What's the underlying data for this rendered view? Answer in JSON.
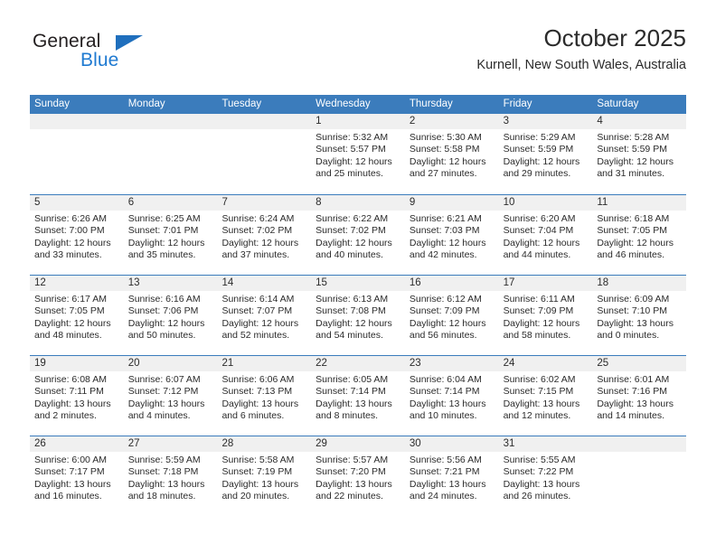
{
  "brand": {
    "name_part1": "General",
    "name_part2": "Blue",
    "triangle_icon": "triangle-icon",
    "accent_color": "#1f7ad1"
  },
  "header": {
    "title": "October 2025",
    "subtitle": "Kurnell, New South Wales, Australia"
  },
  "theme": {
    "header_blue": "#3b7cbc",
    "day_band_gray": "#f0f0f0",
    "text_color": "#2b2b2b"
  },
  "weekdays": [
    "Sunday",
    "Monday",
    "Tuesday",
    "Wednesday",
    "Thursday",
    "Friday",
    "Saturday"
  ],
  "weeks": [
    [
      {
        "day": "",
        "empty": true
      },
      {
        "day": "",
        "empty": true
      },
      {
        "day": "",
        "empty": true
      },
      {
        "day": "1",
        "sunrise": "Sunrise: 5:32 AM",
        "sunset": "Sunset: 5:57 PM",
        "daylight_line1": "Daylight: 12 hours",
        "daylight_line2": "and 25 minutes."
      },
      {
        "day": "2",
        "sunrise": "Sunrise: 5:30 AM",
        "sunset": "Sunset: 5:58 PM",
        "daylight_line1": "Daylight: 12 hours",
        "daylight_line2": "and 27 minutes."
      },
      {
        "day": "3",
        "sunrise": "Sunrise: 5:29 AM",
        "sunset": "Sunset: 5:59 PM",
        "daylight_line1": "Daylight: 12 hours",
        "daylight_line2": "and 29 minutes."
      },
      {
        "day": "4",
        "sunrise": "Sunrise: 5:28 AM",
        "sunset": "Sunset: 5:59 PM",
        "daylight_line1": "Daylight: 12 hours",
        "daylight_line2": "and 31 minutes."
      }
    ],
    [
      {
        "day": "5",
        "sunrise": "Sunrise: 6:26 AM",
        "sunset": "Sunset: 7:00 PM",
        "daylight_line1": "Daylight: 12 hours",
        "daylight_line2": "and 33 minutes."
      },
      {
        "day": "6",
        "sunrise": "Sunrise: 6:25 AM",
        "sunset": "Sunset: 7:01 PM",
        "daylight_line1": "Daylight: 12 hours",
        "daylight_line2": "and 35 minutes."
      },
      {
        "day": "7",
        "sunrise": "Sunrise: 6:24 AM",
        "sunset": "Sunset: 7:02 PM",
        "daylight_line1": "Daylight: 12 hours",
        "daylight_line2": "and 37 minutes."
      },
      {
        "day": "8",
        "sunrise": "Sunrise: 6:22 AM",
        "sunset": "Sunset: 7:02 PM",
        "daylight_line1": "Daylight: 12 hours",
        "daylight_line2": "and 40 minutes."
      },
      {
        "day": "9",
        "sunrise": "Sunrise: 6:21 AM",
        "sunset": "Sunset: 7:03 PM",
        "daylight_line1": "Daylight: 12 hours",
        "daylight_line2": "and 42 minutes."
      },
      {
        "day": "10",
        "sunrise": "Sunrise: 6:20 AM",
        "sunset": "Sunset: 7:04 PM",
        "daylight_line1": "Daylight: 12 hours",
        "daylight_line2": "and 44 minutes."
      },
      {
        "day": "11",
        "sunrise": "Sunrise: 6:18 AM",
        "sunset": "Sunset: 7:05 PM",
        "daylight_line1": "Daylight: 12 hours",
        "daylight_line2": "and 46 minutes."
      }
    ],
    [
      {
        "day": "12",
        "sunrise": "Sunrise: 6:17 AM",
        "sunset": "Sunset: 7:05 PM",
        "daylight_line1": "Daylight: 12 hours",
        "daylight_line2": "and 48 minutes."
      },
      {
        "day": "13",
        "sunrise": "Sunrise: 6:16 AM",
        "sunset": "Sunset: 7:06 PM",
        "daylight_line1": "Daylight: 12 hours",
        "daylight_line2": "and 50 minutes."
      },
      {
        "day": "14",
        "sunrise": "Sunrise: 6:14 AM",
        "sunset": "Sunset: 7:07 PM",
        "daylight_line1": "Daylight: 12 hours",
        "daylight_line2": "and 52 minutes."
      },
      {
        "day": "15",
        "sunrise": "Sunrise: 6:13 AM",
        "sunset": "Sunset: 7:08 PM",
        "daylight_line1": "Daylight: 12 hours",
        "daylight_line2": "and 54 minutes."
      },
      {
        "day": "16",
        "sunrise": "Sunrise: 6:12 AM",
        "sunset": "Sunset: 7:09 PM",
        "daylight_line1": "Daylight: 12 hours",
        "daylight_line2": "and 56 minutes."
      },
      {
        "day": "17",
        "sunrise": "Sunrise: 6:11 AM",
        "sunset": "Sunset: 7:09 PM",
        "daylight_line1": "Daylight: 12 hours",
        "daylight_line2": "and 58 minutes."
      },
      {
        "day": "18",
        "sunrise": "Sunrise: 6:09 AM",
        "sunset": "Sunset: 7:10 PM",
        "daylight_line1": "Daylight: 13 hours",
        "daylight_line2": "and 0 minutes."
      }
    ],
    [
      {
        "day": "19",
        "sunrise": "Sunrise: 6:08 AM",
        "sunset": "Sunset: 7:11 PM",
        "daylight_line1": "Daylight: 13 hours",
        "daylight_line2": "and 2 minutes."
      },
      {
        "day": "20",
        "sunrise": "Sunrise: 6:07 AM",
        "sunset": "Sunset: 7:12 PM",
        "daylight_line1": "Daylight: 13 hours",
        "daylight_line2": "and 4 minutes."
      },
      {
        "day": "21",
        "sunrise": "Sunrise: 6:06 AM",
        "sunset": "Sunset: 7:13 PM",
        "daylight_line1": "Daylight: 13 hours",
        "daylight_line2": "and 6 minutes."
      },
      {
        "day": "22",
        "sunrise": "Sunrise: 6:05 AM",
        "sunset": "Sunset: 7:14 PM",
        "daylight_line1": "Daylight: 13 hours",
        "daylight_line2": "and 8 minutes."
      },
      {
        "day": "23",
        "sunrise": "Sunrise: 6:04 AM",
        "sunset": "Sunset: 7:14 PM",
        "daylight_line1": "Daylight: 13 hours",
        "daylight_line2": "and 10 minutes."
      },
      {
        "day": "24",
        "sunrise": "Sunrise: 6:02 AM",
        "sunset": "Sunset: 7:15 PM",
        "daylight_line1": "Daylight: 13 hours",
        "daylight_line2": "and 12 minutes."
      },
      {
        "day": "25",
        "sunrise": "Sunrise: 6:01 AM",
        "sunset": "Sunset: 7:16 PM",
        "daylight_line1": "Daylight: 13 hours",
        "daylight_line2": "and 14 minutes."
      }
    ],
    [
      {
        "day": "26",
        "sunrise": "Sunrise: 6:00 AM",
        "sunset": "Sunset: 7:17 PM",
        "daylight_line1": "Daylight: 13 hours",
        "daylight_line2": "and 16 minutes."
      },
      {
        "day": "27",
        "sunrise": "Sunrise: 5:59 AM",
        "sunset": "Sunset: 7:18 PM",
        "daylight_line1": "Daylight: 13 hours",
        "daylight_line2": "and 18 minutes."
      },
      {
        "day": "28",
        "sunrise": "Sunrise: 5:58 AM",
        "sunset": "Sunset: 7:19 PM",
        "daylight_line1": "Daylight: 13 hours",
        "daylight_line2": "and 20 minutes."
      },
      {
        "day": "29",
        "sunrise": "Sunrise: 5:57 AM",
        "sunset": "Sunset: 7:20 PM",
        "daylight_line1": "Daylight: 13 hours",
        "daylight_line2": "and 22 minutes."
      },
      {
        "day": "30",
        "sunrise": "Sunrise: 5:56 AM",
        "sunset": "Sunset: 7:21 PM",
        "daylight_line1": "Daylight: 13 hours",
        "daylight_line2": "and 24 minutes."
      },
      {
        "day": "31",
        "sunrise": "Sunrise: 5:55 AM",
        "sunset": "Sunset: 7:22 PM",
        "daylight_line1": "Daylight: 13 hours",
        "daylight_line2": "and 26 minutes."
      },
      {
        "day": "",
        "empty": true
      }
    ]
  ]
}
